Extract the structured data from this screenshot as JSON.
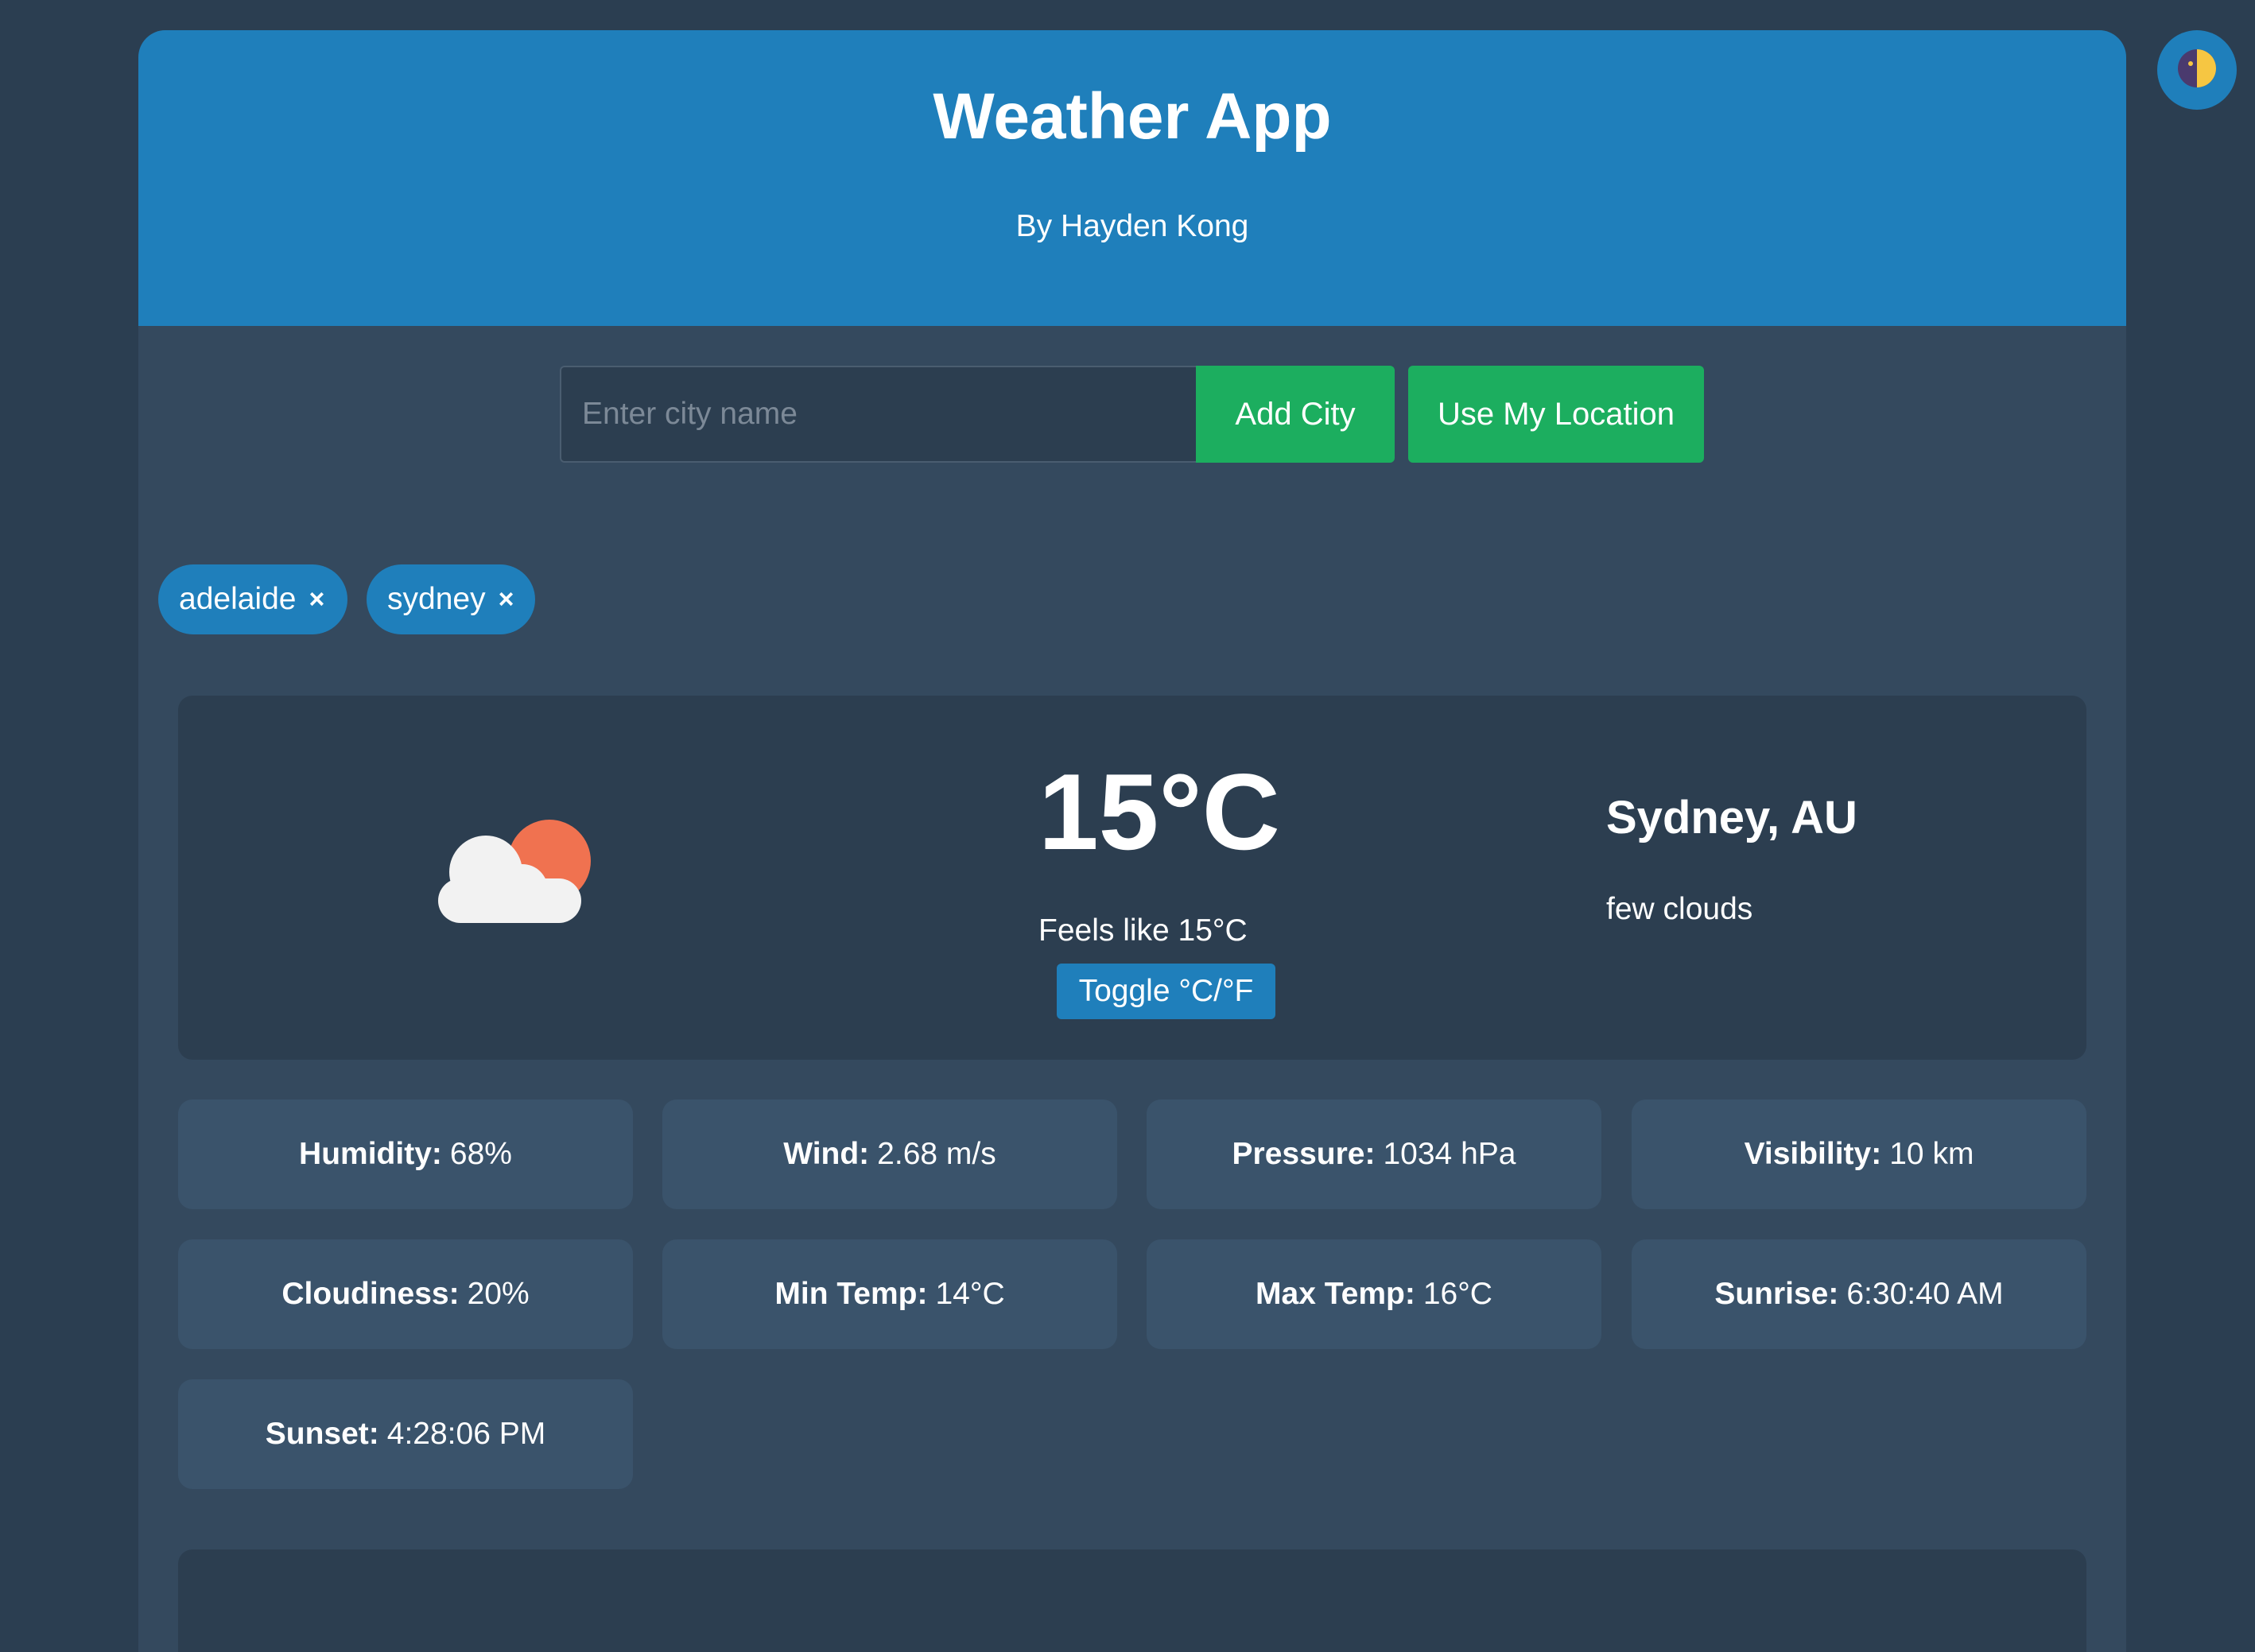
{
  "header": {
    "title": "Weather App",
    "subtitle": "By Hayden Kong"
  },
  "search": {
    "placeholder": "Enter city name",
    "value": "",
    "add_label": "Add City",
    "location_label": "Use My Location"
  },
  "cities": [
    {
      "label": "adelaide",
      "remove": "×"
    },
    {
      "label": "sydney",
      "remove": "×"
    }
  ],
  "current": {
    "icon": "cloud-sun-icon",
    "temperature": "15°C",
    "feels_like": "Feels like 15°C",
    "toggle_label": "Toggle °C/°F",
    "location": "Sydney, AU",
    "description": "few clouds"
  },
  "details": [
    {
      "label": "Humidity:",
      "value": "68%"
    },
    {
      "label": "Wind:",
      "value": "2.68 m/s"
    },
    {
      "label": "Pressure:",
      "value": "1034 hPa"
    },
    {
      "label": "Visibility:",
      "value": "10 km"
    },
    {
      "label": "Cloudiness:",
      "value": "20%"
    },
    {
      "label": "Min Temp:",
      "value": "14°C"
    },
    {
      "label": "Max Temp:",
      "value": "16°C"
    },
    {
      "label": "Sunrise:",
      "value": "6:30:40 AM"
    },
    {
      "label": "Sunset:",
      "value": "4:28:06 PM"
    }
  ],
  "theme_toggle": {
    "icon": "half-moon-icon"
  },
  "colors": {
    "page_bg": "#2b3e51",
    "container_bg": "#34495e",
    "header_bg": "#1f7fbb",
    "card_bg": "#2c3e50",
    "detail_bg": "#3a536b",
    "button_green": "#1cae5f",
    "sun": "#f07250",
    "cloud": "#f2f2f2"
  }
}
